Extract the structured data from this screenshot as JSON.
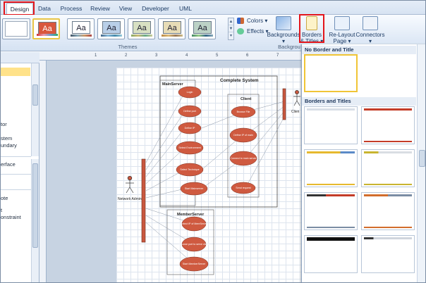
{
  "tabs": [
    "Design",
    "Data",
    "Process",
    "Review",
    "View",
    "Developer",
    "UML"
  ],
  "ribbon": {
    "colors_label": "Colors",
    "effects_label": "Effects",
    "themes_group": "Themes",
    "backgrounds_label": "Backgrounds",
    "borders_label": "Borders",
    "borders_label2": "& Titles",
    "relayout_label": "Re-Layout",
    "relayout_label2": "Page",
    "connectors_label": "Connectors",
    "backgrounds_group": "Backgrou",
    "theme_aa": "Aa",
    "accent": "#e3151b"
  },
  "left_panel": {
    "items": [
      "tor",
      "stem",
      "undary",
      "erface",
      "ote",
      "t",
      "onstraint"
    ]
  },
  "ruler": {
    "h": [
      "1",
      "2",
      "3",
      "4",
      "5",
      "6",
      "7",
      "8"
    ]
  },
  "diagram": {
    "system_title": "Complete System",
    "mainserver": "MainServer",
    "client": "Client",
    "memberserver": "MemberServer",
    "actor_left": "Network Admin",
    "actor_right": "Clien",
    "main_ellipses": [
      "Login",
      "Define port",
      "Define IP",
      "Select Environment",
      "Select Technique",
      "Start Mainserver"
    ],
    "client_ellipses": [
      "Browse File",
      "Define IP of main",
      "Connect to main server",
      "Send request"
    ],
    "member_ellipses": [
      "Select IP of MemServer",
      "Choose port to serve client",
      "Start MemberServer"
    ]
  },
  "gallery": {
    "head1": "No Border and Title",
    "head2": "Borders and Titles"
  }
}
